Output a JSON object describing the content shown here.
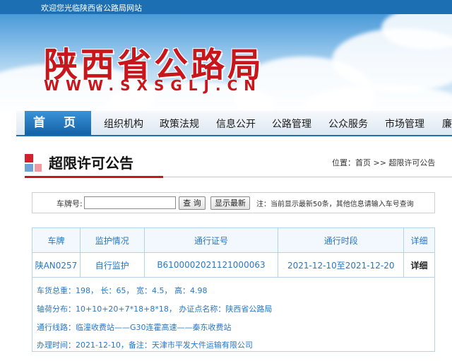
{
  "topbar": {
    "welcome": "欢迎您光临陕西省公路局网站"
  },
  "banner": {
    "site_name": "陕西省公路局",
    "site_url": "WWW.SXSGLJ.CN"
  },
  "nav": {
    "home": "首 页",
    "items": [
      "组织机构",
      "政策法规",
      "信息公开",
      "公路管理",
      "公众服务",
      "市场管理",
      "廉"
    ]
  },
  "section": {
    "title": "超限许可公告",
    "breadcrumb": "位置：首页 >> 超限许可公告"
  },
  "search": {
    "plate_label": "车牌号:",
    "plate_value": "",
    "query_button": "查 询",
    "latest_button": "显示最新",
    "note": "注：当前显示最新50条，其他信息请输入车号查询"
  },
  "table": {
    "headers": [
      "车牌",
      "监护情况",
      "通行证号",
      "通行时段",
      "详细"
    ],
    "rows": [
      [
        "陕AN0257",
        "自行监护",
        "B6100002021121000063",
        "2021-12-10至2021-12-20",
        "详细"
      ]
    ]
  },
  "details": [
    "车货总重：198， 长：65， 宽：4.5， 高：4.98",
    "轴荷分布：10+10+20+7*18+8*18， 办证点名称：陕西省公路局",
    "通行线路：临潼收费站——G30连霍高速——秦东收费站",
    "办理时间：2021-12-10，备注：天津市平发大件运输有限公司"
  ],
  "colors": {
    "brand_red": "#c8171c",
    "nav_blue": "#1e6fb0",
    "link_blue": "#2877c4"
  }
}
